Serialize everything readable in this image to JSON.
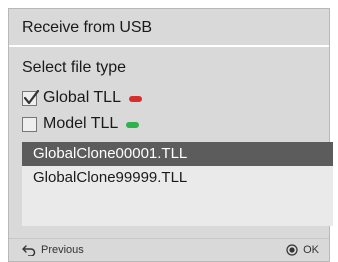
{
  "dialog": {
    "title": "Receive from USB",
    "subtitle": "Select file type"
  },
  "file_types": [
    {
      "label": "Global TLL",
      "checked": true,
      "indicator_color": "#d62d2d"
    },
    {
      "label": "Model TLL",
      "checked": false,
      "indicator_color": "#2fb24a"
    }
  ],
  "files": [
    {
      "name": "GlobalClone00001.TLL",
      "selected": true
    },
    {
      "name": "GlobalClone99999.TLL",
      "selected": false
    }
  ],
  "footer": {
    "previous_label": "Previous",
    "ok_label": "OK"
  },
  "colors": {
    "selected_row": "#5c5c5c",
    "panel": "#d9d9d9",
    "list_bg": "#eaeaea"
  }
}
